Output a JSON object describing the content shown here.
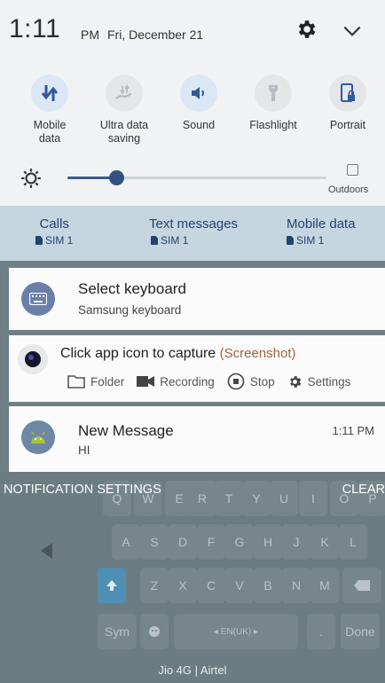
{
  "status": {
    "time": "1:11",
    "ampm": "PM",
    "date": "Fri, December 21"
  },
  "toggles": [
    {
      "label": "Mobile\ndata",
      "icon": "mobile-data-icon",
      "state": "on"
    },
    {
      "label": "Ultra data\nsaving",
      "icon": "ultra-data-saving-icon",
      "state": "off"
    },
    {
      "label": "Sound",
      "icon": "sound-icon",
      "state": "on"
    },
    {
      "label": "Flashlight",
      "icon": "flashlight-icon",
      "state": "off"
    },
    {
      "label": "Portrait",
      "icon": "portrait-lock-icon",
      "state": "off"
    }
  ],
  "brightness": {
    "level": 0.19,
    "outdoors_label": "Outdoors"
  },
  "sims": [
    {
      "title": "Calls",
      "sim": "SIM 1"
    },
    {
      "title": "Text messages",
      "sim": "SIM 1"
    },
    {
      "title": "Mobile data",
      "sim": "SIM 1"
    }
  ],
  "notifications": {
    "keyboard": {
      "title": "Select keyboard",
      "subtitle": "Samsung keyboard"
    },
    "screenshot": {
      "title": "Click app icon to capture",
      "app": "(Screenshot)",
      "actions": {
        "folder": "Folder",
        "recording": "Recording",
        "stop": "Stop",
        "settings": "Settings"
      }
    },
    "message": {
      "title": "New Message",
      "subtitle": "HI",
      "time": "1:11 PM"
    }
  },
  "footer": {
    "settings": "NOTIFICATION SETTINGS",
    "clear": "CLEAR"
  },
  "keyboard_keys": {
    "row1": [
      "Q",
      "W",
      "E",
      "R",
      "T",
      "Y",
      "U",
      "I",
      "O",
      "P"
    ],
    "row2": [
      "A",
      "S",
      "D",
      "F",
      "G",
      "H",
      "J",
      "K",
      "L"
    ],
    "row3": [
      "Z",
      "X",
      "C",
      "V",
      "B",
      "N",
      "M"
    ],
    "sym": "Sym",
    "lang": "◂ EN(UK) ▸",
    "period": ".",
    "done": "Done"
  },
  "carrier": "Jio 4G | Airtel",
  "colors": {
    "accent": "#2f5280",
    "sim_bar": "#c5d6e1",
    "screenshot_app": "#a0633b"
  }
}
